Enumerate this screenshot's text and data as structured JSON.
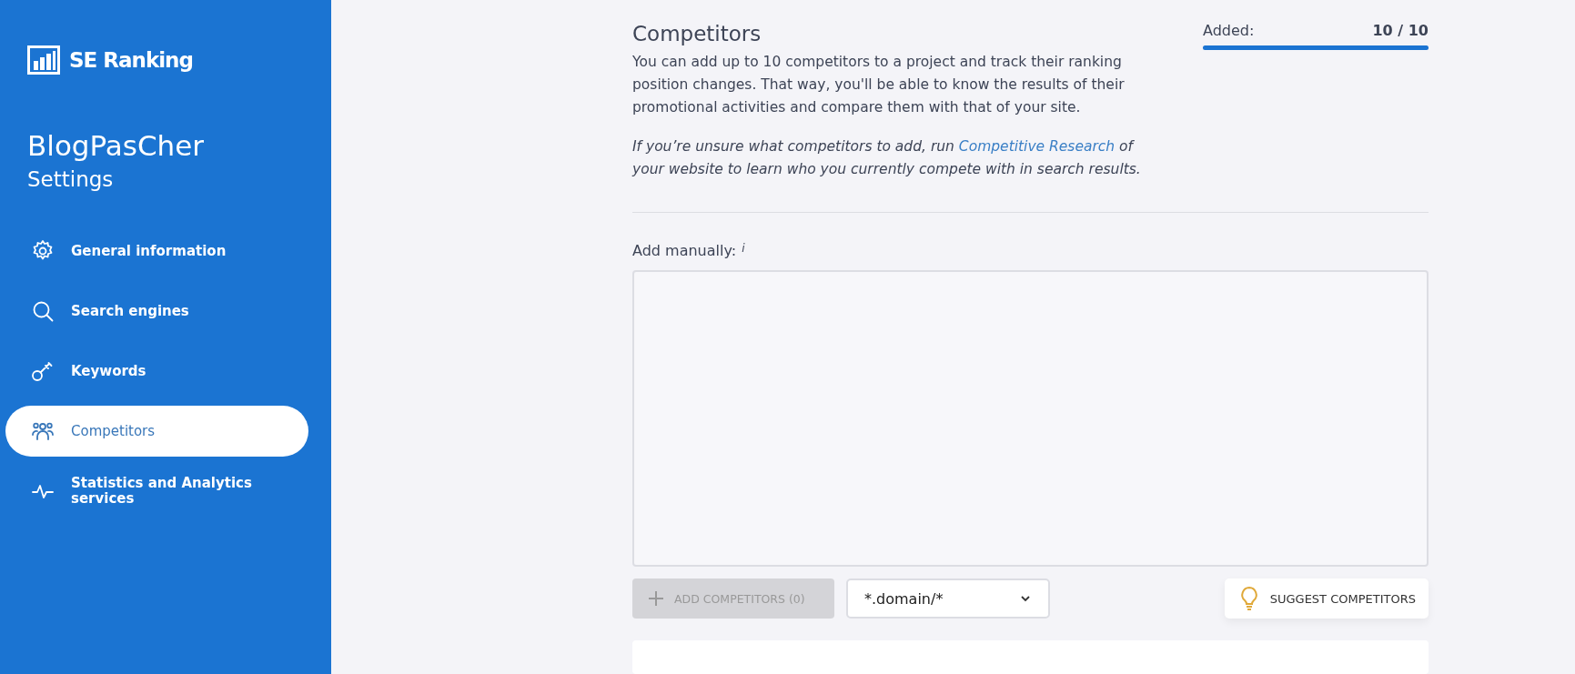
{
  "sidebar": {
    "logo": "SE Ranking",
    "project": "BlogPasCher",
    "subtitle": "Settings",
    "items": [
      {
        "label": "General information",
        "kind": "gear",
        "selected": false
      },
      {
        "label": "Search engines",
        "kind": "search",
        "selected": false
      },
      {
        "label": "Keywords",
        "kind": "key",
        "selected": false
      },
      {
        "label": "Competitors",
        "kind": "people",
        "selected": true
      },
      {
        "label": "Statistics and Analytics services",
        "kind": "pulse",
        "selected": false
      }
    ]
  },
  "header": {
    "title": "Competitors",
    "description": "You can add up to 10 competitors to a project and track their ranking position changes. That way, you'll be able to know the results of their promotional activities and compare them with that of your site.",
    "hint_before": "If you’re unsure what competitors to add, run",
    "hint_link": "Competitive Research",
    "hint_after": "of your website to learn who you currently compete with in search results."
  },
  "added": {
    "label": "Added:",
    "count": "10 / 10",
    "level": 1
  },
  "manual": {
    "label": "Add manually:",
    "info": "i"
  },
  "add_button": {
    "label": "ADD COMPETITORS (0)",
    "disabled": true
  },
  "domain_select": {
    "value": "*.domain/*"
  },
  "suggest_button": {
    "label": "SUGGEST COMPETITORS"
  }
}
